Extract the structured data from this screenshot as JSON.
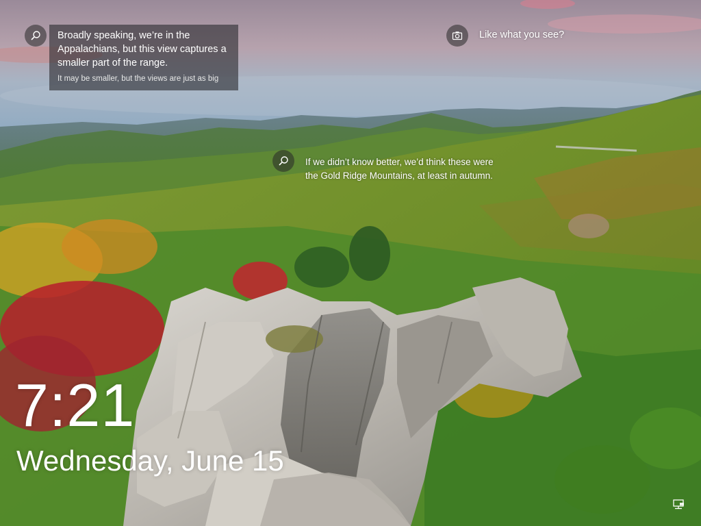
{
  "lockscreen": {
    "spotlight_card": {
      "title": "Broadly speaking, we’re in the Appalachians, but this view captures a smaller part of the range.",
      "subtitle": "It may be smaller, but the views are just as big",
      "icon": "search-icon"
    },
    "hotspot_caption": {
      "text": "If we didn’t know better, we’d think these were the Gold Ridge Mountains, at least in autumn.",
      "icon": "search-icon"
    },
    "like_prompt": {
      "text": "Like what you see?",
      "icon": "camera-icon"
    },
    "time": "7:21",
    "date": "Wednesday, June 15",
    "network_icon": "network-ethernet-icon"
  }
}
